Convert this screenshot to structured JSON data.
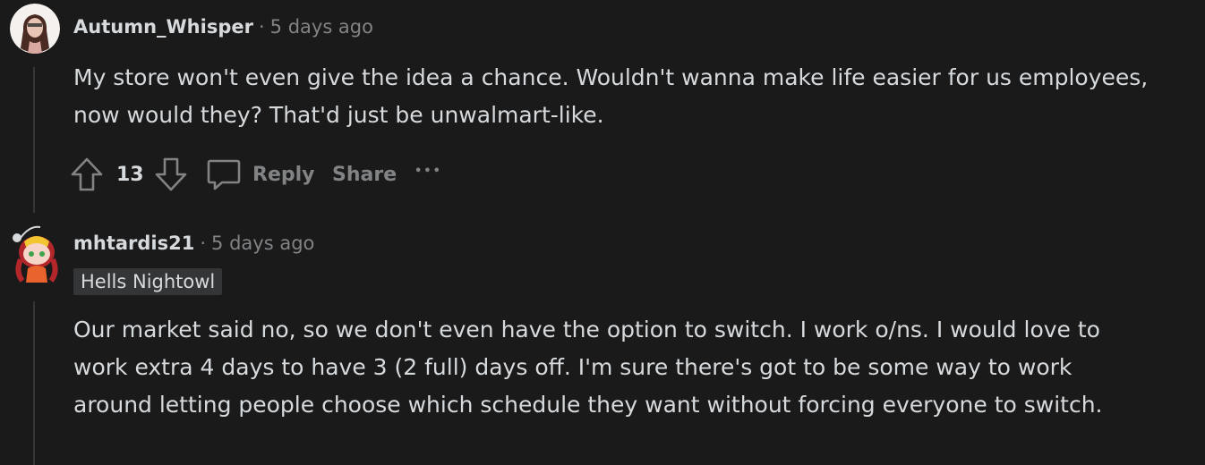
{
  "comments": [
    {
      "author": "Autumn_Whisper",
      "separator": "·",
      "time": "5 days ago",
      "body": "My store won't even give the idea a chance. Wouldn't wanna make life easier for us employees, now would they? That'd just be unwalmart-like.",
      "votes": "13",
      "reply_label": "Reply",
      "share_label": "Share",
      "more_label": "•••"
    },
    {
      "author": "mhtardis21",
      "separator": "·",
      "time": "5 days ago",
      "flair": "Hells Nightowl",
      "body": "Our market said no, so we don't even have the option to switch. I work o/ns. I would love to work extra 4 days to have 3 (2 full) days off. I'm sure there's got to be some way to work around letting people choose which schedule they want without forcing everyone to switch."
    }
  ],
  "colors": {
    "background": "#1a1a1b",
    "text": "#d7dadc",
    "muted": "#818384",
    "thread_line": "#343536",
    "flair_bg": "#343536"
  },
  "icons": [
    "upvote-icon",
    "downvote-icon",
    "comment-bubble-icon"
  ]
}
